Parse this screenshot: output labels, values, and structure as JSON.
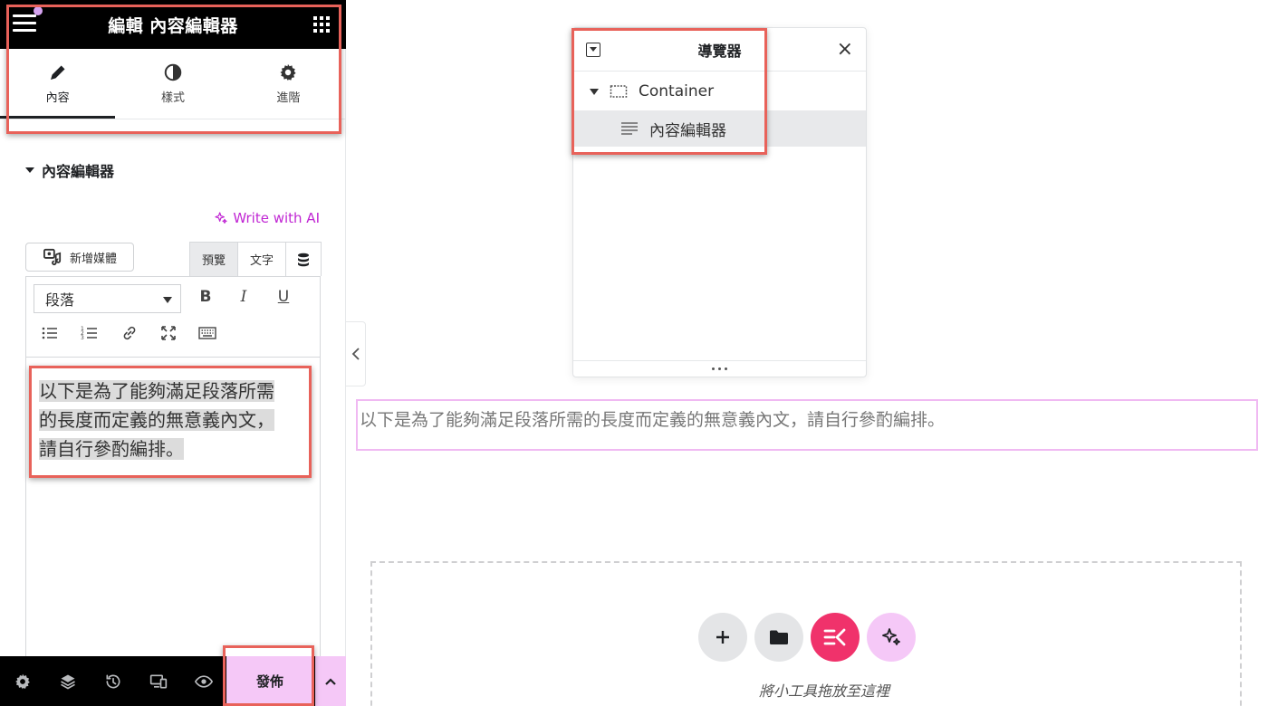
{
  "panel": {
    "header_title": "編輯 內容編輯器",
    "tabs": [
      {
        "label": "內容",
        "icon": "pencil-icon",
        "active": true
      },
      {
        "label": "樣式",
        "icon": "half-circle-icon",
        "active": false
      },
      {
        "label": "進階",
        "icon": "gear-icon",
        "active": false
      }
    ],
    "section_title": "內容編輯器",
    "ai_link": "Write with AI",
    "media_button": "新增媒體",
    "mode_tabs": {
      "preview": "預覽",
      "text": "文字"
    },
    "format_select": "段落",
    "toolbar": {
      "bold": "B",
      "italic": "I",
      "underline": "U"
    },
    "content_text_line1": "以下是為了能夠滿足段落所需",
    "content_text_line2": "的長度而定義的無意義內文，",
    "content_text_line3": "請自行參酌編排。",
    "publish_label": "發佈"
  },
  "navigator": {
    "title": "導覽器",
    "items": [
      {
        "label": "Container",
        "icon": "container-icon"
      },
      {
        "label": "內容編輯器",
        "icon": "text-editor-icon"
      }
    ]
  },
  "canvas": {
    "text": "以下是為了能夠滿足段落所需的長度而定義的無意義內文，請自行參酌編排。",
    "drop_label": "將小工具拖放至這裡"
  },
  "colors": {
    "accent_pink": "#f0326b",
    "publish_bg": "#f5c8f7",
    "highlight": "#e8625a",
    "ai_purple": "#c026d3"
  }
}
